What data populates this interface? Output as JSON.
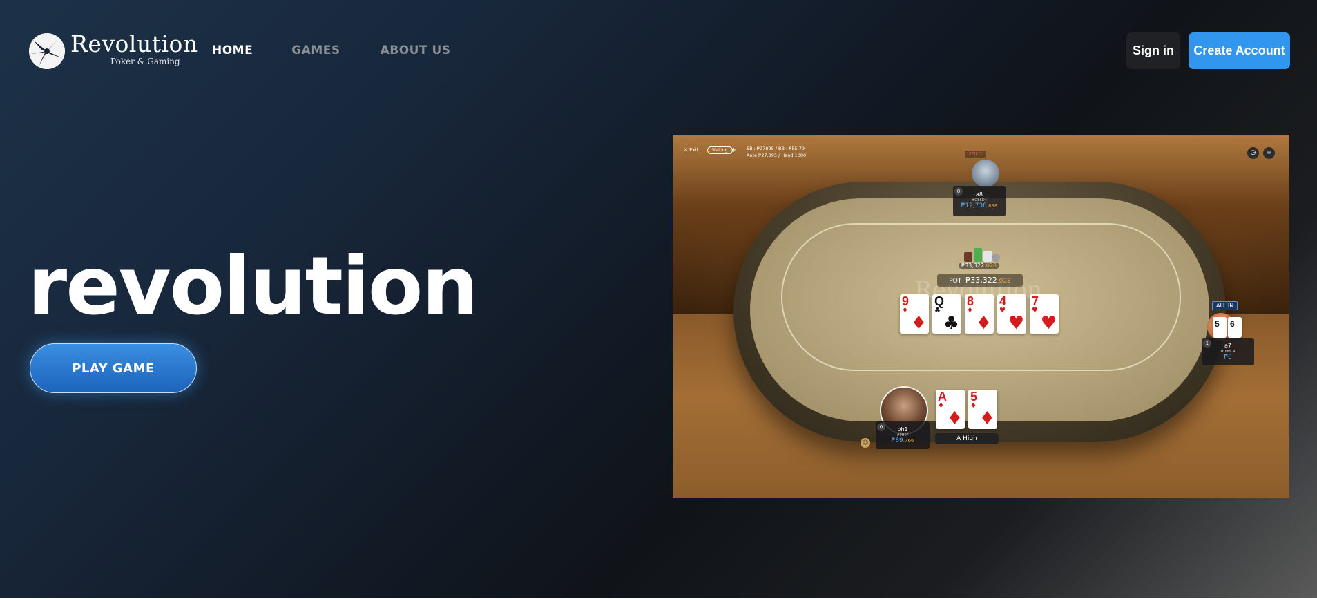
{
  "header": {
    "logo": {
      "name": "Revolution",
      "tagline": "Poker & Gaming"
    },
    "nav": {
      "home": "HOME",
      "games": "GAMES",
      "about": "ABOUT US"
    },
    "sign_in": "Sign in",
    "create_account": "Create Account"
  },
  "hero": {
    "title": "revolution",
    "play_button": "PLAY GAME"
  },
  "game": {
    "exit_label": "Exit",
    "status": "Waiting",
    "plus": "+",
    "blinds_line1": "SB : ₱27895 / BB : ₱55.79",
    "blinds_line2": "Ante ₱27.895 / Hand 1080",
    "watermark": "Revolution",
    "fold_tag": "FOLD",
    "allin_tag": "ALL IN",
    "pot_label": "POT",
    "pot_value": "₱33,322",
    "pot_decimals": ".028",
    "chips_amount": "₱33,322",
    "chips_decimals": ".028",
    "community_cards": [
      {
        "rank": "9",
        "suit": "♦",
        "color": "red"
      },
      {
        "rank": "Q",
        "suit": "♣",
        "color": "blk"
      },
      {
        "rank": "8",
        "suit": "♦",
        "color": "red"
      },
      {
        "rank": "4",
        "suit": "♥",
        "color": "red"
      },
      {
        "rank": "7",
        "suit": "♥",
        "color": "red"
      }
    ],
    "players": {
      "top": {
        "seat": "0",
        "name": "a8",
        "id": "#OB6D4",
        "stack": "₱12,738",
        "decimals": ".898"
      },
      "right": {
        "seat": "1",
        "name": "a7",
        "id": "#09HC4",
        "stack": "₱0",
        "cards": [
          "5",
          "6"
        ]
      },
      "hero": {
        "seat": "0",
        "name": "ph1",
        "id": "#PH0F",
        "stack": "₱89",
        "decimals": ".766"
      }
    },
    "hero_cards": [
      {
        "rank": "A",
        "suit": "♦",
        "color": "red"
      },
      {
        "rank": "5",
        "suit": "♦",
        "color": "red"
      }
    ],
    "hand_label": "A High",
    "colors": {
      "accent": "#3197ee",
      "fold": "#e25555",
      "stack": "#5aa8f2"
    }
  }
}
